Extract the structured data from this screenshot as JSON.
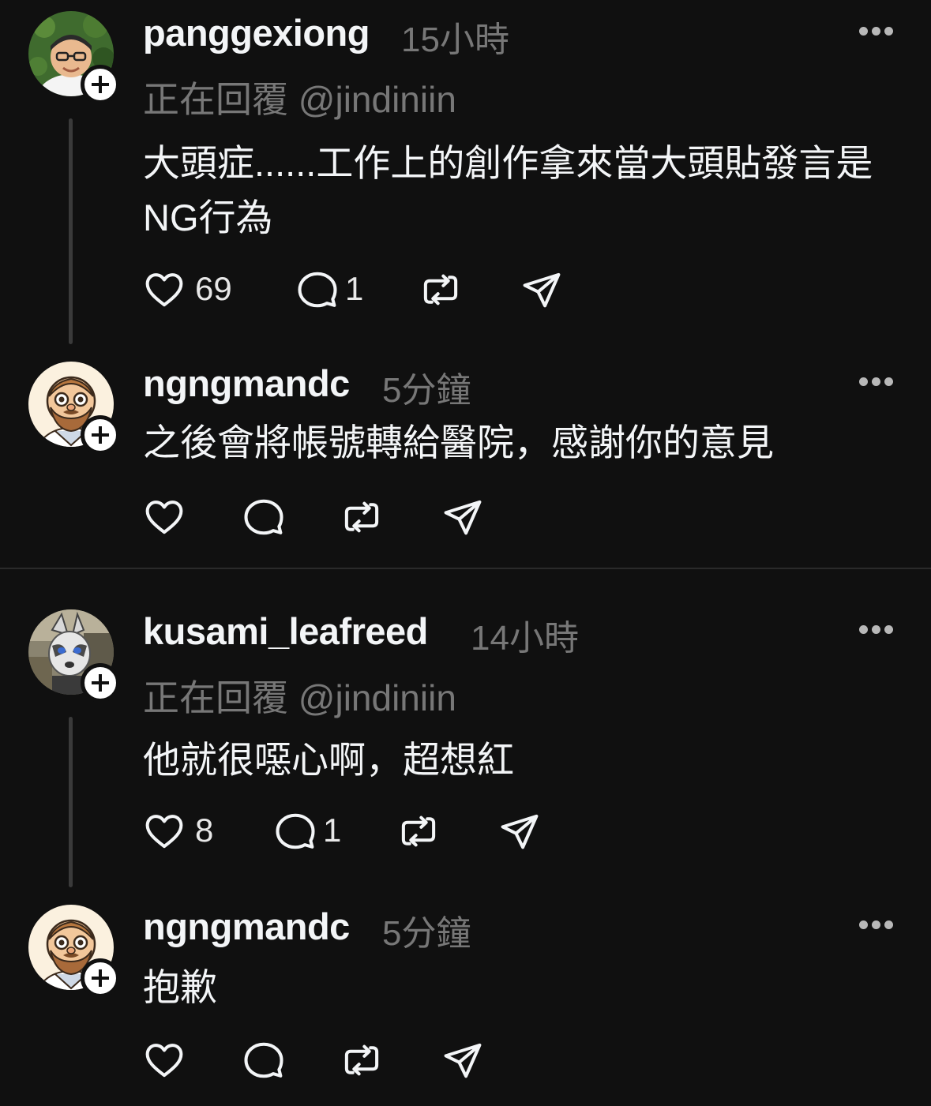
{
  "thread1": {
    "parent": {
      "username": "panggexiong",
      "time": "15小時",
      "replying": "正在回覆 @jindiniin",
      "text": "大頭症......工作上的創作拿來當大頭貼發言是NG行為",
      "like_count": "69",
      "reply_count": "1"
    },
    "reply": {
      "username": "ngngmandc",
      "time": "5分鐘",
      "text": "之後會將帳號轉給醫院，感謝你的意見"
    }
  },
  "thread2": {
    "parent": {
      "username": "kusami_leafreed",
      "time": "14小時",
      "replying": "正在回覆 @jindiniin",
      "text": "他就很噁心啊，超想紅",
      "like_count": "8",
      "reply_count": "1"
    },
    "reply": {
      "username": "ngngmandc",
      "time": "5分鐘",
      "text": "抱歉"
    }
  },
  "icons": {
    "like": "heart-icon",
    "reply": "comment-bubble-icon",
    "repost": "repost-icon",
    "share": "send-icon",
    "more": "more-horizontal-icon",
    "follow": "plus-icon"
  },
  "colors": {
    "background": "#101010",
    "text": "#f3f5f7",
    "secondary_text": "#777777",
    "thread_line": "#3a3a3a"
  }
}
